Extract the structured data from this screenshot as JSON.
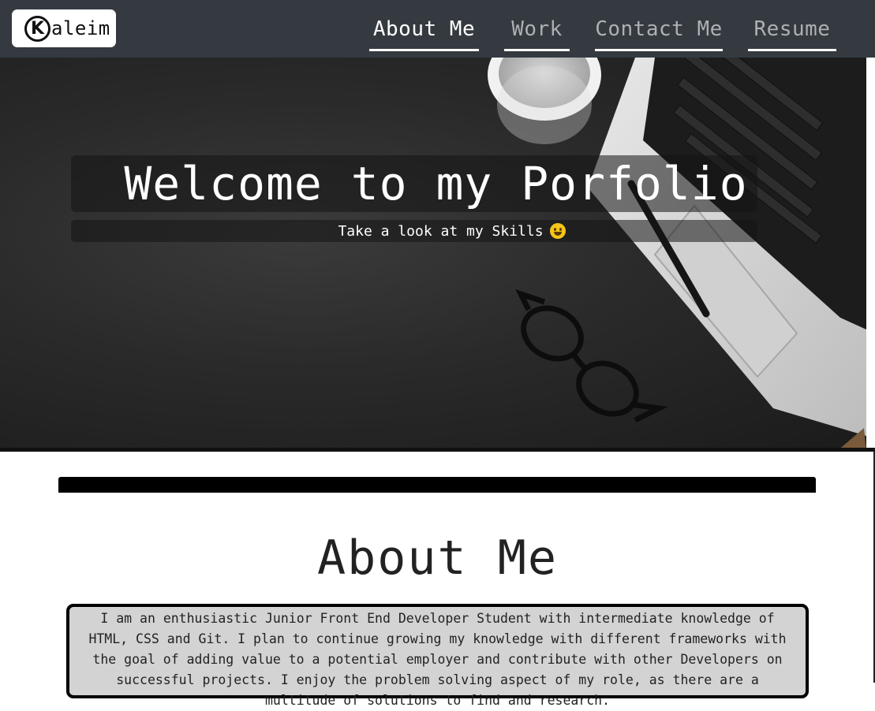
{
  "brand": {
    "logo_letter": "K",
    "logo_text": "aleim"
  },
  "nav": {
    "items": [
      {
        "label": "About Me",
        "active": true
      },
      {
        "label": "Work",
        "active": false
      },
      {
        "label": "Contact Me",
        "active": false
      },
      {
        "label": "Resume",
        "active": false
      }
    ]
  },
  "hero": {
    "title": "Welcome to my Porfolio",
    "subtitle": "Take a look at my Skills"
  },
  "about": {
    "heading": "About Me",
    "body": "I am an enthusiastic Junior Front End Developer Student with intermediate knowledge of HTML, CSS and Git. I plan to continue growing my knowledge with different frameworks with the goal of adding value to a potential employer and contribute with other Developers on successful projects. I enjoy the problem solving aspect of my role, as there are a multitude of solutions to find and research."
  },
  "colors": {
    "navbar": "#343a40",
    "nav_active": "#ffffff",
    "nav_inactive": "#adb0b4",
    "about_box_bg": "#d3d3d3"
  },
  "icons": {
    "subtitle_emoji": "grinning-face-icon"
  }
}
